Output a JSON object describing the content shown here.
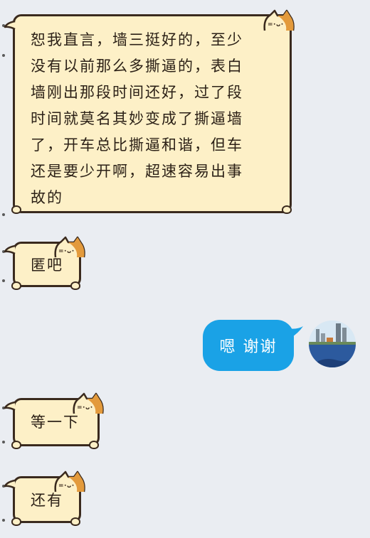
{
  "messages": [
    {
      "side": "left",
      "text": "恕我直言，墙三挺好的，至少\n没有以前那么多撕逼的，表白\n墙刚出那段时间还好，过了段\n时间就莫名其妙变成了撕逼墙\n了，开车总比撕逼和谐，但车\n还是要少开啊，超速容易出事\n故的"
    },
    {
      "side": "left",
      "text": "匿吧"
    },
    {
      "side": "right",
      "text": "嗯 谢谢"
    },
    {
      "side": "left",
      "text": "等一下"
    },
    {
      "side": "left",
      "text": "还有"
    }
  ],
  "colors": {
    "background": "#eaedf2",
    "cat_bubble_fill": "#fdf0c7",
    "cat_bubble_outline": "#3a2a1e",
    "cat_orange": "#e39a3c",
    "blue_bubble": "#1aa2e6"
  },
  "icons": {
    "cat_decoration": "cat-head-icon",
    "avatar": "user-avatar-city-photo"
  }
}
